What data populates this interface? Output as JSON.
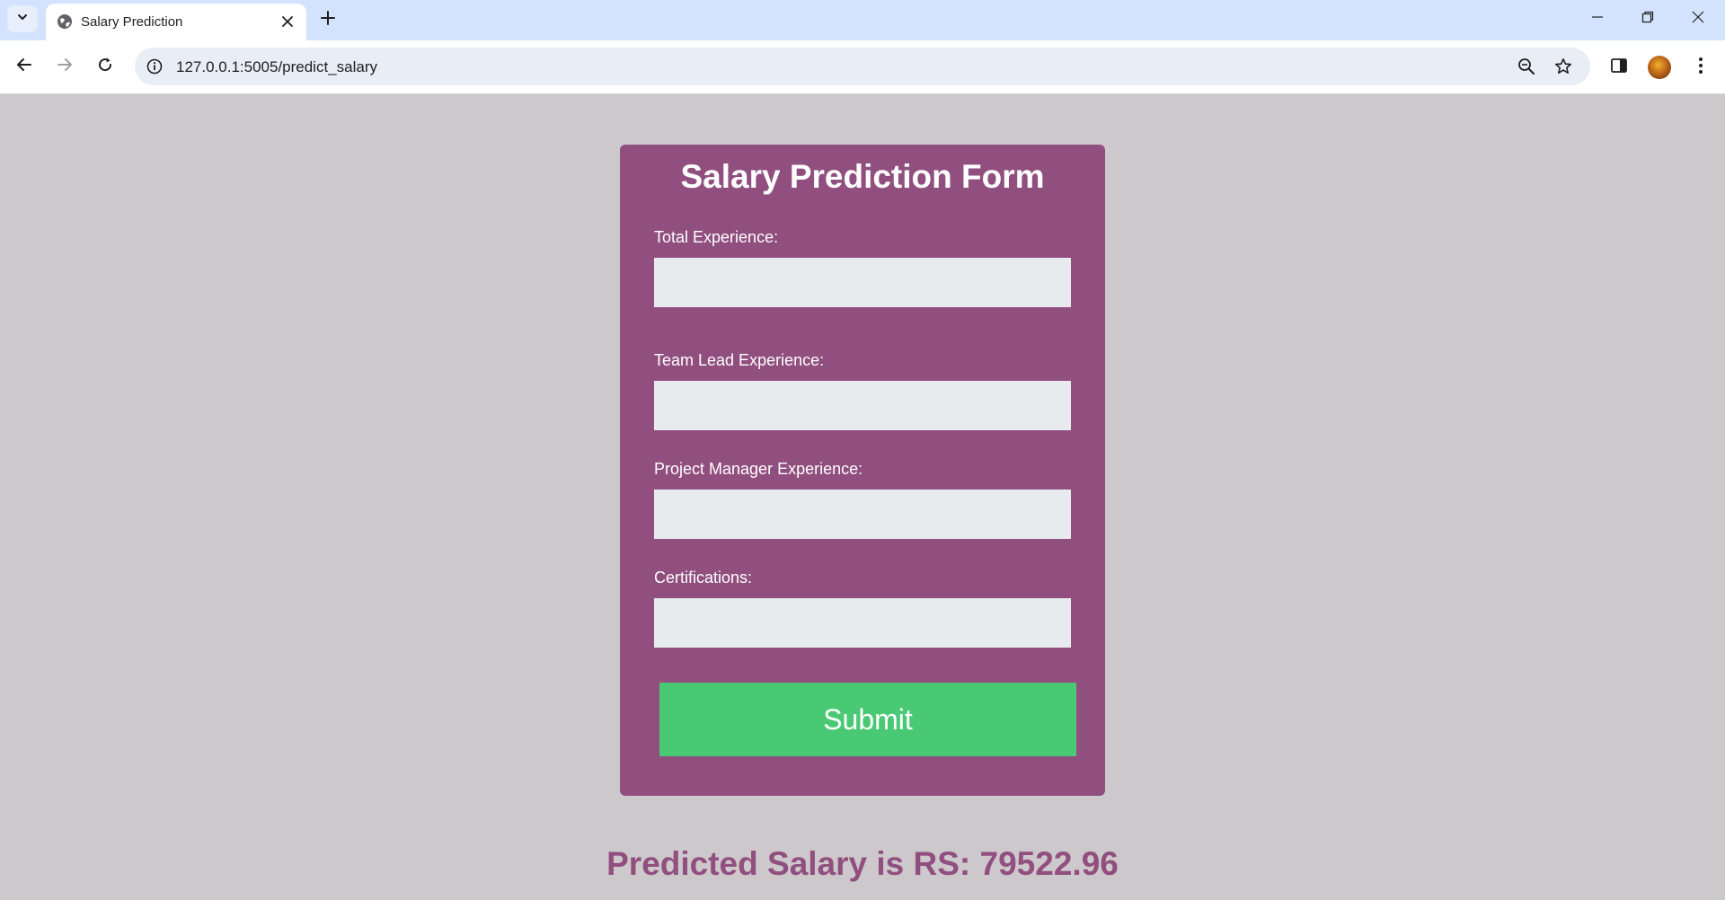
{
  "browser": {
    "tab_title": "Salary Prediction",
    "url": "127.0.0.1:5005/predict_salary"
  },
  "form": {
    "title": "Salary Prediction Form",
    "fields": [
      {
        "label": "Total Experience:",
        "value": ""
      },
      {
        "label": "Team Lead Experience:",
        "value": ""
      },
      {
        "label": "Project Manager Experience:",
        "value": ""
      },
      {
        "label": "Certifications:",
        "value": ""
      }
    ],
    "submit_label": "Submit"
  },
  "result": {
    "text": "Predicted Salary is RS: 79522.96"
  },
  "colors": {
    "page_bg": "#cdc8cc",
    "card_bg": "#914f7f",
    "input_bg": "#e8ebee",
    "submit_bg": "#4ac974",
    "result_text": "#914f7f"
  }
}
